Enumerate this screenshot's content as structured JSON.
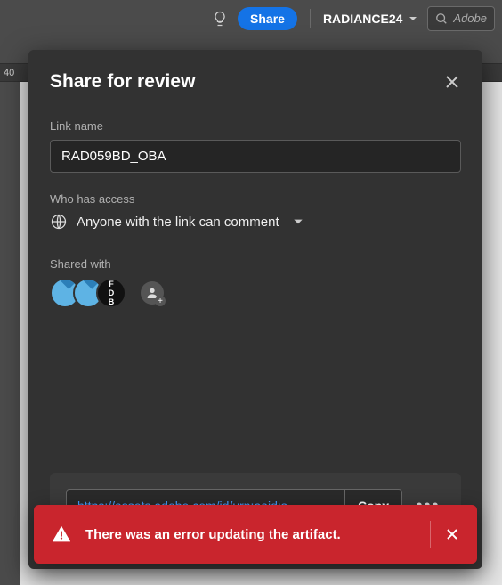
{
  "topbar": {
    "share_label": "Share",
    "user_name": "RADIANCE24",
    "search_placeholder": "Adobe"
  },
  "ruler": {
    "tick": "40"
  },
  "modal": {
    "title": "Share for review",
    "link_name_label": "Link name",
    "link_name_value": "RAD059BD_OBA",
    "access_label": "Who has access",
    "access_value": "Anyone with the link can comment",
    "shared_with_label": "Shared with",
    "avatars": {
      "dark_initials_top": "F",
      "dark_initials_mid": "D",
      "dark_initials_bot": "B"
    },
    "link_url": "https://assets.adobe.com/id/urn:aaid:s…",
    "copy_label": "Copy"
  },
  "error": {
    "message": "There was an error updating the artifact."
  }
}
